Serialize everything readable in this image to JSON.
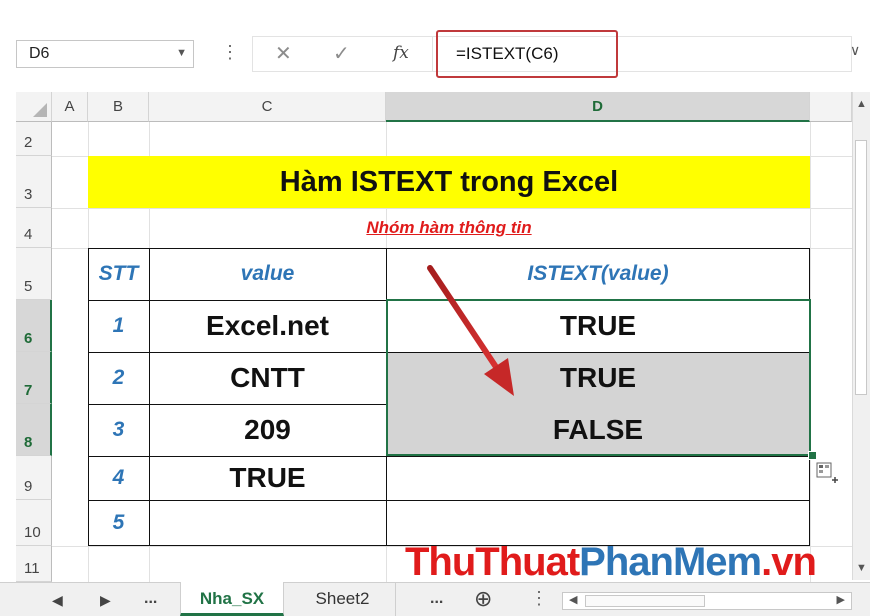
{
  "formula_bar": {
    "name_box": "D6",
    "cancel_icon": "✕",
    "enter_icon": "✓",
    "fx_label": "fx",
    "formula": "=ISTEXT(C6)"
  },
  "columns": [
    "A",
    "B",
    "C",
    "D"
  ],
  "rows": [
    "2",
    "3",
    "4",
    "5",
    "6",
    "7",
    "8",
    "9",
    "10",
    "11"
  ],
  "sheet": {
    "title": "Hàm ISTEXT trong Excel",
    "subtitle": "Nhóm hàm thông tin",
    "headers": [
      "STT",
      "value",
      "ISTEXT(value)"
    ],
    "data": [
      {
        "stt": "1",
        "value": "Excel.net",
        "result": "TRUE"
      },
      {
        "stt": "2",
        "value": "CNTT",
        "result": "TRUE"
      },
      {
        "stt": "3",
        "value": "209",
        "result": "FALSE"
      },
      {
        "stt": "4",
        "value": "TRUE",
        "result": ""
      },
      {
        "stt": "5",
        "value": "",
        "result": ""
      }
    ]
  },
  "tabs": {
    "ellipsis": "...",
    "items": [
      "Nha_SX",
      "Sheet2"
    ],
    "active": "Nha_SX",
    "more": "...",
    "add_icon": "⊕"
  },
  "watermark": {
    "part1": "ThuThuat",
    "part2": "PhanMem",
    "part3": ".vn"
  },
  "colors": {
    "accent": "#217346",
    "title_bg": "#ffff00",
    "header_blue": "#2e75b6",
    "subtitle_red": "#e01b1b",
    "highlight_box": "#c0393b",
    "arrow": "#c62828"
  }
}
